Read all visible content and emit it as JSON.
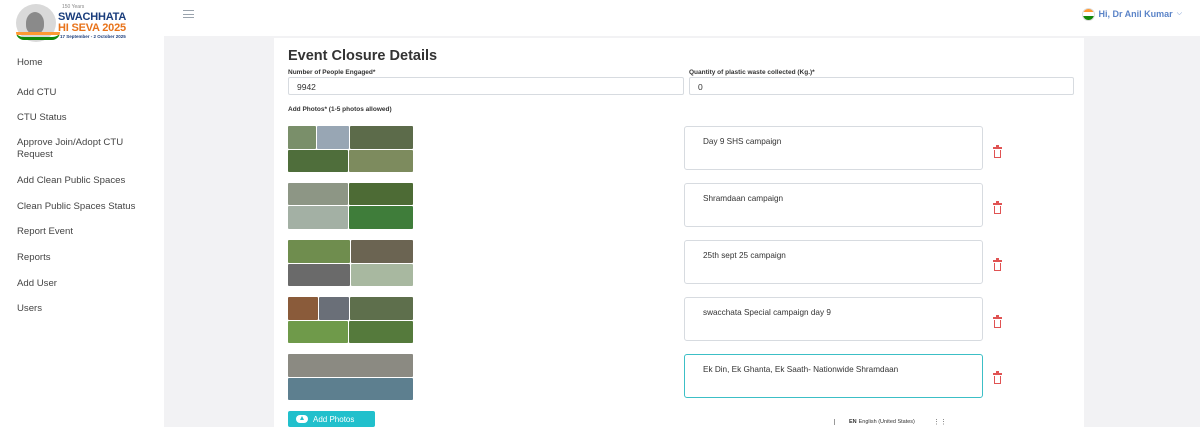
{
  "logo": {
    "top_text": "SWACHHATA",
    "bottom_text": "HI SEVA 2025",
    "dates": "17 September - 2 October 2025",
    "subtext": "150 Years"
  },
  "sidebar": {
    "items": [
      {
        "label": "Home"
      },
      {
        "label": "Add CTU"
      },
      {
        "label": "CTU Status"
      },
      {
        "label": "Approve Join/Adopt CTU Request"
      },
      {
        "label": "Add Clean Public Spaces"
      },
      {
        "label": "Clean Public Spaces Status"
      },
      {
        "label": "Report Event"
      },
      {
        "label": "Reports"
      },
      {
        "label": "Add User"
      },
      {
        "label": "Users"
      }
    ]
  },
  "header": {
    "greeting": "Hi, Dr Anil Kumar",
    "icons": {
      "menu": "hamburger-icon",
      "flag": "india-flag-icon",
      "dropdown": "chevron-down-icon"
    }
  },
  "form": {
    "title": "Event Closure Details",
    "people_label": "Number of People Engaged*",
    "people_value": "9942",
    "plastic_label": "Quantity of plastic waste collected (Kg.)*",
    "plastic_value": "0",
    "photos_label": "Add Photos* (1-5 photos allowed)",
    "photos": [
      {
        "description": "Day 9 SHS campaign"
      },
      {
        "description": "Shramdaan campaign"
      },
      {
        "description": "25th sept 25 campaign"
      },
      {
        "description": "swacchata Special campaign day 9"
      },
      {
        "description": "Ek Din, Ek Ghanta, Ek Saath- Nationwide Shramdaan"
      }
    ],
    "add_button": "Add Photos"
  },
  "footer": {
    "lang_code": "EN",
    "lang_name": "English (United States)"
  },
  "colors": {
    "accent": "#21c0cc",
    "delete": "#e05353",
    "user_link": "#5b84c8",
    "brand_orange": "#e8731a",
    "brand_blue": "#1a3d7c"
  }
}
